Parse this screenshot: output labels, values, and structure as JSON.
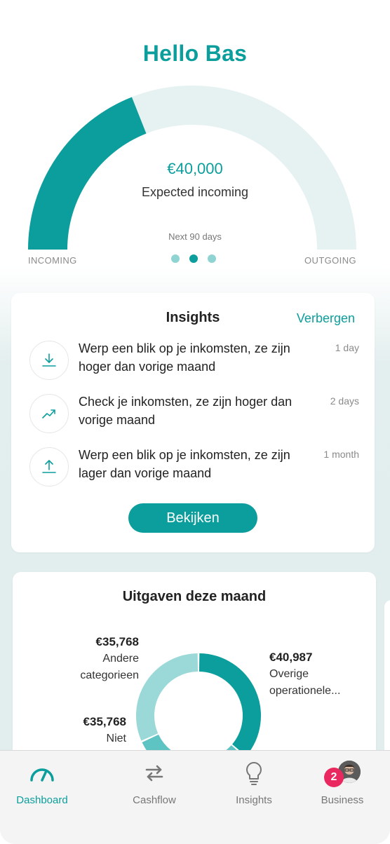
{
  "greeting": "Hello Bas",
  "gauge": {
    "amount": "€40,000",
    "caption": "Expected incoming",
    "period": "Next 90 days",
    "left_label": "INCOMING",
    "right_label": "OUTGOING",
    "incoming_fraction": 0.38,
    "pages": 3,
    "active_page": 2
  },
  "insights": {
    "title": "Insights",
    "hide_label": "Verbergen",
    "items": [
      {
        "icon": "download-icon",
        "text": "Werp een blik op je inkomsten, ze zijn hoger dan vorige maand",
        "time": "1 day"
      },
      {
        "icon": "trending-up-icon",
        "text": "Check je inkomsten, ze zijn hoger dan vorige maand",
        "time": "2 days"
      },
      {
        "icon": "upload-icon",
        "text": "Werp een blik op je inkomsten, ze zijn lager dan vorige maand",
        "time": "1 month"
      }
    ],
    "button_label": "Bekijken"
  },
  "expenses": {
    "title": "Uitgaven deze maand",
    "legend": [
      {
        "amount": "€35,768",
        "label": "Andere categorieen"
      },
      {
        "amount": "€40,987",
        "label": "Overige operationele..."
      },
      {
        "amount": "€35,768",
        "label": "Niet"
      }
    ]
  },
  "chart_data": {
    "type": "pie",
    "title": "Uitgaven deze maand",
    "categories": [
      "Overige operationele...",
      "Niet",
      "Andere categorieen"
    ],
    "values": [
      40987,
      35768,
      35768
    ]
  },
  "nav": [
    {
      "label": "Dashboard",
      "icon": "gauge-icon",
      "active": true
    },
    {
      "label": "Cashflow",
      "icon": "swap-arrows-icon",
      "active": false
    },
    {
      "label": "Insights",
      "icon": "lightbulb-icon",
      "active": false
    },
    {
      "label": "Business",
      "icon": "avatar",
      "active": false,
      "badge": "2"
    }
  ],
  "colors": {
    "accent": "#0b9e9c",
    "accent_light": "#8fd4d3",
    "gauge_track": "#e6f1f1",
    "badge": "#e8285e"
  }
}
